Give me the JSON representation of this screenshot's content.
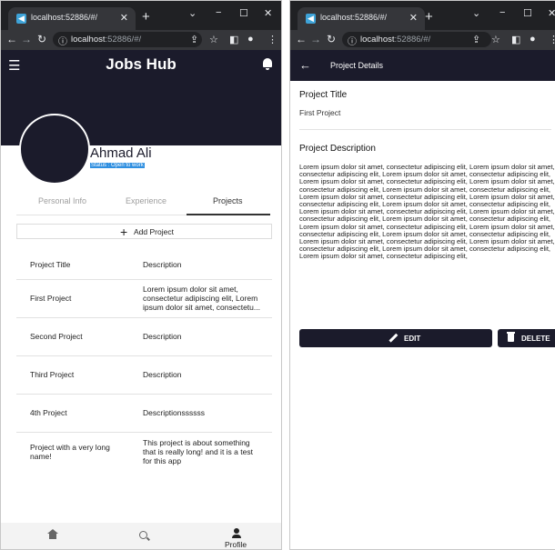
{
  "left_window": {
    "tab_title": "localhost:52886/#/",
    "url_host": "localhost",
    "url_path": ":52886/#/",
    "app": {
      "title": "Jobs Hub",
      "profile_name": "Ahmad Ali",
      "status": "Status : Open to work",
      "tabs": [
        "Personal Info",
        "Experience",
        "Projects"
      ],
      "active_tab": "Projects",
      "add_project_label": "Add Project",
      "table": {
        "headers": [
          "Project Title",
          "Description"
        ],
        "rows": [
          {
            "title": "First Project",
            "description": "Lorem ipsum dolor sit amet, consectetur adipiscing elit, Lorem ipsum dolor sit amet, consectetu..."
          },
          {
            "title": "Second Project",
            "description": "Description"
          },
          {
            "title": "Third Project",
            "description": "Description"
          },
          {
            "title": "4th Project",
            "description": "Descriptionssssss"
          },
          {
            "title": "Project with a very long name!",
            "description": "This project is about something that is really long! and it is a test for this app"
          }
        ]
      },
      "bottom_nav": {
        "profile_label": "Profile"
      }
    }
  },
  "right_window": {
    "tab_title": "localhost:52886/#/",
    "url_host": "localhost",
    "url_path": ":52886/#/",
    "app": {
      "header_title": "Project Details",
      "title_heading": "Project Title",
      "title_value": "First Project",
      "description_heading": "Project Description",
      "description_text": "Lorem ipsum dolor sit amet, consectetur adipiscing elit, Lorem ipsum dolor sit amet, consectetur adipiscing elit, Lorem ipsum dolor sit amet, consectetur adipiscing elit, Lorem ipsum dolor sit amet, consectetur adipiscing elit, Lorem ipsum dolor sit amet, consectetur adipiscing elit, Lorem ipsum dolor sit amet, consectetur adipiscing elit, Lorem ipsum dolor sit amet, consectetur adipiscing elit, Lorem ipsum dolor sit amet, consectetur adipiscing elit, Lorem ipsum dolor sit amet, consectetur adipiscing elit, Lorem ipsum dolor sit amet, consectetur adipiscing elit, Lorem ipsum dolor sit amet, consectetur adipiscing elit, Lorem ipsum dolor sit amet, consectetur adipiscing elit, Lorem ipsum dolor sit amet, consectetur adipiscing elit, Lorem ipsum dolor sit amet, consectetur adipiscing elit, Lorem ipsum dolor sit amet, consectetur adipiscing elit, Lorem ipsum dolor sit amet, consectetur adipiscing elit, Lorem ipsum dolor sit amet, consectetur adipiscing elit, Lorem ipsum dolor sit amet, consectetur adipiscing elit, Lorem ipsum dolor sit amet, consectetur adipiscing elit,",
      "edit_label": "EDIT",
      "delete_label": "DELETE"
    }
  },
  "colors": {
    "primary": "#1b1b2b",
    "status_badge": "#2f8fe0"
  },
  "icons": [
    "menu-icon",
    "bell-icon",
    "plus-icon",
    "home-icon",
    "search-icon",
    "person-icon",
    "back-arrow-icon",
    "pencil-icon",
    "trash-icon"
  ]
}
